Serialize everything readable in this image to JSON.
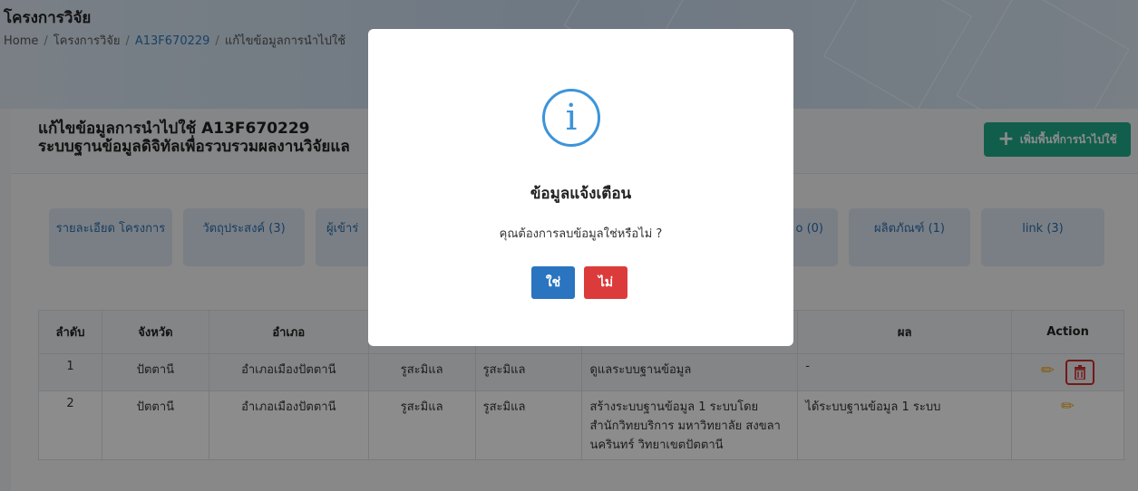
{
  "header": {
    "title": "โครงการวิจัย",
    "breadcrumb": [
      "Home",
      "โครงการวิจัย",
      "A13F670229",
      "แก้ไขข้อมูลการนำไปใช้"
    ]
  },
  "card": {
    "title_line1": "แก้ไขข้อมูลการนำไปใช้ A13F670229",
    "title_line2": "ระบบฐานข้อมูลดิจิทัลเพื่อรวบรวมผลงานวิจัยแล",
    "add_button": "เพิ่มพื้นที่การนำไปใช้"
  },
  "tabs": [
    {
      "label": "รายละเอียด โครงการ"
    },
    {
      "label": "วัตถุประสงค์ (3)"
    },
    {
      "label": "ผู้เข้าร่"
    },
    {
      "label": "o (0)"
    },
    {
      "label": "ผลิตภัณฑ์ (1)"
    },
    {
      "label": "link (3)"
    }
  ],
  "table": {
    "headers": [
      "ลำดับ",
      "จังหวัด",
      "อำเภอ",
      "",
      "",
      "",
      "ผล",
      "Action"
    ],
    "rows": [
      {
        "no": "1",
        "province": "ปัตตานี",
        "district": "อำเภอเมืองปัตตานี",
        "sub1": "รูสะมิแล",
        "sub2": "รูสะมิแล",
        "detail": "ดูแลระบบฐานข้อมูล",
        "result": "-"
      },
      {
        "no": "2",
        "province": "ปัตตานี",
        "district": "อำเภอเมืองปัตตานี",
        "sub1": "รูสะมิแล",
        "sub2": "รูสะมิแล",
        "detail": "สร้างระบบฐานข้อมูล 1 ระบบโดย สำนักวิทยบริการ มหาวิทยาลัย สงขลานครินทร์ วิทยาเขตปัตตานี",
        "result": "ได้ระบบฐานข้อมูล 1 ระบบ"
      }
    ]
  },
  "modal": {
    "icon": "i",
    "title": "ข้อมูลแจ้งเตือน",
    "message": "คุณต้องการลบข้อมูลใช่หรือไม่ ?",
    "yes": "ใช่",
    "no": "ไม่"
  },
  "colors": {
    "accent_green": "#1fab8a",
    "link_blue": "#2a7ab8",
    "yes_button": "#2a74c0",
    "no_button": "#dc3b3b",
    "info_icon": "#3d94d9",
    "edit_icon": "#f0a81c",
    "delete_icon": "#d02e2e"
  }
}
